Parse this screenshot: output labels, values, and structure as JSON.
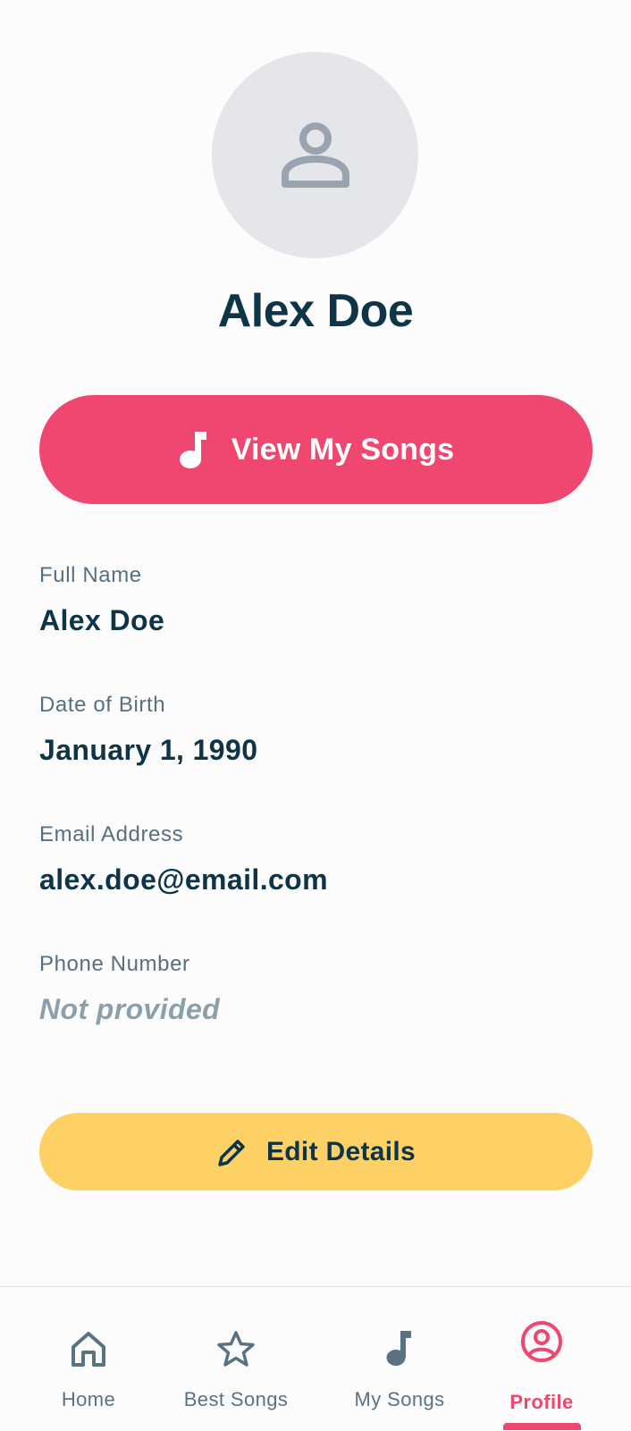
{
  "profile": {
    "name": "Alex Doe",
    "avatar_icon": "person-icon",
    "view_songs_label": "View My Songs",
    "view_songs_icon": "music-note-icon"
  },
  "fields": [
    {
      "label": "Full Name",
      "value": "Alex Doe"
    },
    {
      "label": "Date of Birth",
      "value": "January 1, 1990"
    },
    {
      "label": "Email Address",
      "value": "alex.doe@email.com"
    },
    {
      "label": "Phone Number",
      "value": "Not provided"
    }
  ],
  "edit": {
    "label": "Edit Details",
    "icon": "pencil-icon"
  },
  "tabs": [
    {
      "label": "Home",
      "icon": "home-icon"
    },
    {
      "label": "Best Songs",
      "icon": "star-icon"
    },
    {
      "label": "My Songs",
      "icon": "music-note-icon"
    },
    {
      "label": "Profile",
      "icon": "user-circle-icon",
      "active": true
    }
  ],
  "colors": {
    "accent": "#ef4770",
    "secondary": "#fdd166",
    "text_primary": "#0d3447",
    "text_secondary": "#567080",
    "muted": "#8ba0ad",
    "avatar_bg": "#e5e6ea"
  }
}
